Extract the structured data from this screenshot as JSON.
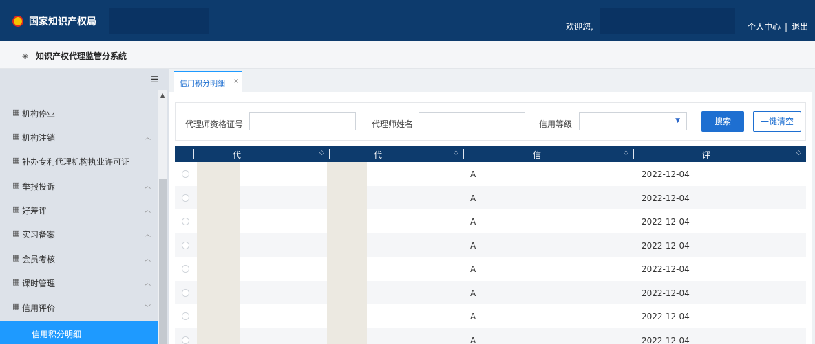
{
  "header": {
    "title": "国家知识产权局",
    "welcome": "欢迎您,",
    "user_center": "个人中心",
    "separator": "|",
    "logout": "退出"
  },
  "subheader": {
    "system_name": "知识产权代理监管分系统"
  },
  "sidebar": {
    "items": [
      {
        "label": "机构停业",
        "expandable": false
      },
      {
        "label": "机构注销",
        "expandable": true
      },
      {
        "label": "补办专利代理机构执业许可证",
        "expandable": false
      },
      {
        "label": "举报投诉",
        "expandable": true
      },
      {
        "label": "好差评",
        "expandable": true
      },
      {
        "label": "实习备案",
        "expandable": true
      },
      {
        "label": "会员考核",
        "expandable": true
      },
      {
        "label": "课时管理",
        "expandable": true
      },
      {
        "label": "信用评价",
        "expandable": true,
        "expanded": true
      }
    ],
    "active_subitem": "信用积分明细"
  },
  "tabs": [
    {
      "label": "信用积分明细",
      "close": "×"
    }
  ],
  "search": {
    "cert_label": "代理师资格证号",
    "cert_value": "",
    "name_label": "代理师姓名",
    "name_value": "",
    "level_label": "信用等级",
    "level_value": "",
    "search_button": "搜索",
    "clear_button": "一键清空"
  },
  "table": {
    "columns": [
      "代理师资格证号",
      "代理师姓名",
      "信用等级",
      "评价日期"
    ],
    "rows": [
      {
        "level": "A",
        "date": "2022-12-04"
      },
      {
        "level": "A",
        "date": "2022-12-04"
      },
      {
        "level": "A",
        "date": "2022-12-04"
      },
      {
        "level": "A",
        "date": "2022-12-04"
      },
      {
        "level": "A",
        "date": "2022-12-04"
      },
      {
        "level": "A",
        "date": "2022-12-04"
      },
      {
        "level": "A",
        "date": "2022-12-04"
      },
      {
        "level": "A",
        "date": "2022-12-04"
      }
    ]
  },
  "colors": {
    "header_bg": "#0d3b6d",
    "accent": "#1e9aff",
    "button_primary": "#1e6fd1",
    "sidebar_bg": "#dde2e9"
  },
  "icons": {
    "logo": "national-emblem-icon",
    "system": "layers-icon",
    "collapse": "collapse-menu-icon",
    "menu": "grid-icon",
    "chevron": "chevron-up-icon",
    "sort": "sort-icon",
    "dropdown": "chevron-down-icon"
  }
}
